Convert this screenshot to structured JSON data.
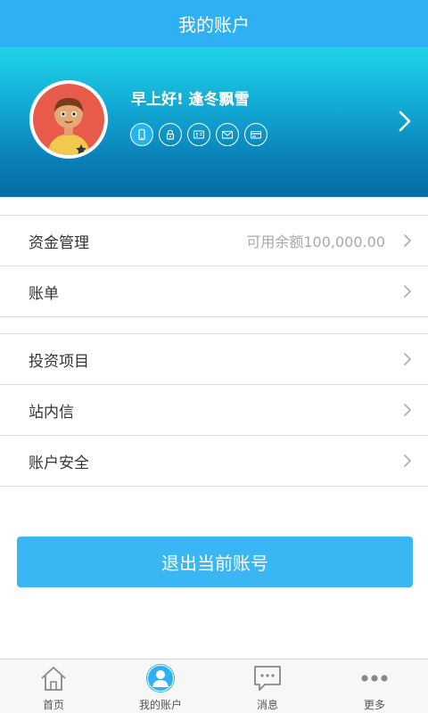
{
  "header": {
    "title": "我的账户"
  },
  "profile": {
    "greeting": "早上好! 逢冬飘雪",
    "badges": [
      "phone-icon",
      "lock-icon",
      "id-card-icon",
      "mail-icon",
      "bank-card-icon"
    ]
  },
  "menu": {
    "group1": [
      {
        "label": "资金管理",
        "value": "可用余额100,000.00"
      },
      {
        "label": "账单"
      }
    ],
    "group2": [
      {
        "label": "投资项目"
      },
      {
        "label": "站内信"
      },
      {
        "label": "账户安全"
      }
    ]
  },
  "logout": {
    "label": "退出当前账号"
  },
  "tabs": [
    {
      "label": "首页",
      "icon": "home-icon"
    },
    {
      "label": "我的账户",
      "icon": "user-icon",
      "active": true
    },
    {
      "label": "消息",
      "icon": "message-icon"
    },
    {
      "label": "更多",
      "icon": "more-icon"
    }
  ],
  "colors": {
    "accent": "#30b0f4",
    "button": "#3ab6f5"
  }
}
